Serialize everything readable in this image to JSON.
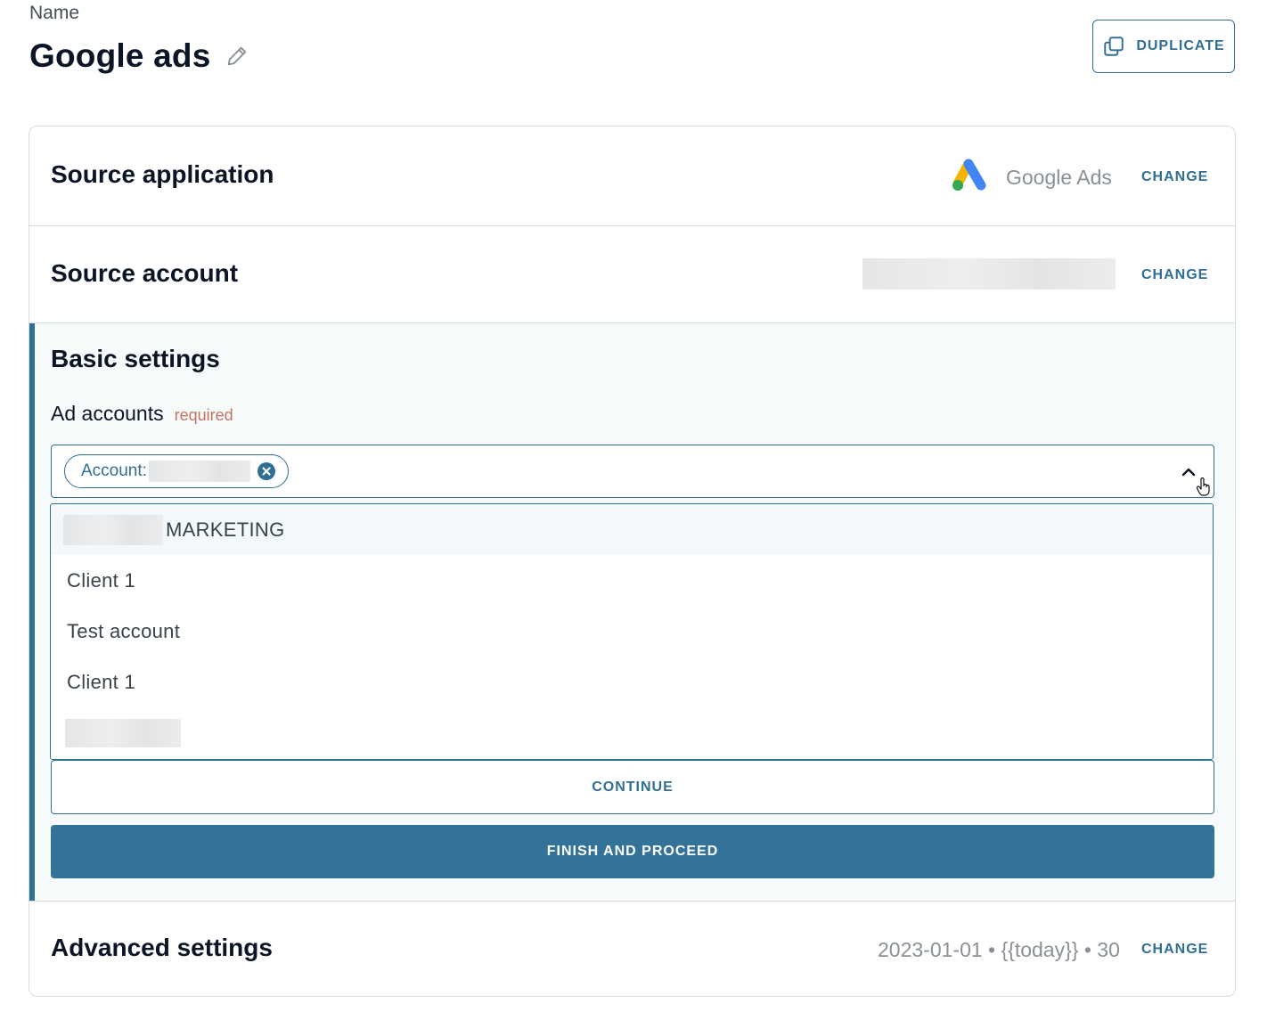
{
  "header": {
    "name_label": "Name",
    "title": "Google ads",
    "duplicate_label": "DUPLICATE"
  },
  "source_application": {
    "title": "Source application",
    "app_name": "Google Ads",
    "change_label": "CHANGE"
  },
  "source_account": {
    "title": "Source account",
    "change_label": "CHANGE"
  },
  "basic_settings": {
    "title": "Basic settings",
    "ad_accounts_label": "Ad accounts",
    "required_label": "required",
    "chip_label": "Account:",
    "options": [
      {
        "label": "MARKETING",
        "highlighted": true
      },
      {
        "label": "Client 1"
      },
      {
        "label": "Test account"
      },
      {
        "label": "Client 1"
      }
    ],
    "continue_label": "CONTINUE",
    "finish_label": "FINISH AND PROCEED"
  },
  "advanced_settings": {
    "title": "Advanced settings",
    "summary": "2023-01-01 • {{today}} • 30",
    "change_label": "CHANGE"
  },
  "colors": {
    "accent": "#2f6f94",
    "primary_button": "#337399",
    "required": "#c27262"
  },
  "icons": {
    "edit": "pencil-icon",
    "duplicate": "copy-icon",
    "chip_remove": "close-circle-icon",
    "dropdown_toggle": "chevron-up-icon",
    "cursor": "hand-pointer-icon",
    "app_logo": "google-ads-logo-icon"
  }
}
